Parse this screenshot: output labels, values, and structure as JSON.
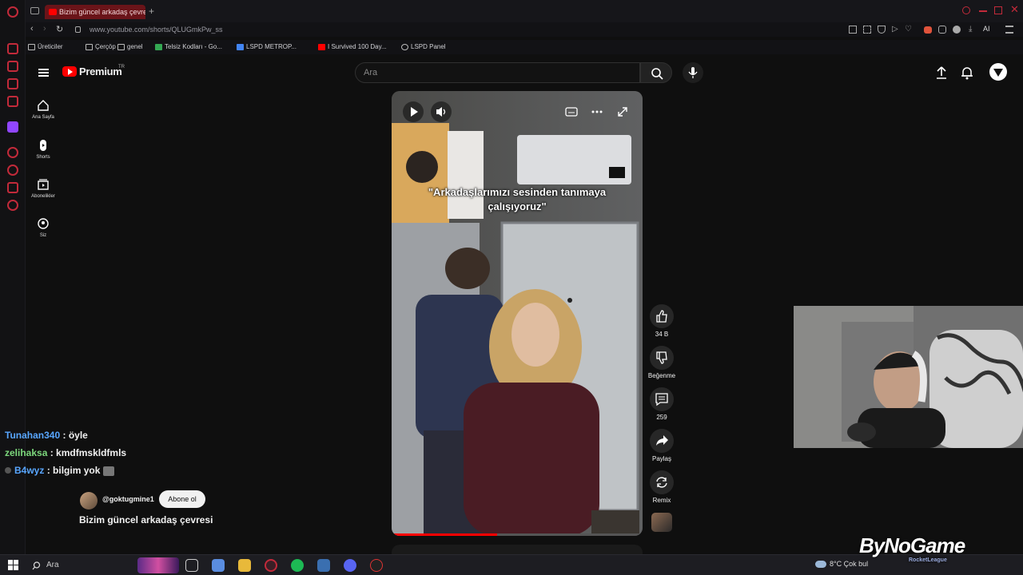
{
  "browser": {
    "tab_title": "Bizim güncel arkadaş çevresi",
    "url": "www.youtube.com/shorts/QLUGmkPw_ss",
    "bookmarks": [
      "Üreticiler",
      "Çerçöp",
      "genel",
      "Telsiz Kodları - Go...",
      "LSPD METROP...",
      "I Survived 100 Day...",
      "LSPD Panel"
    ],
    "toolbar_ai": "AI"
  },
  "youtube": {
    "logo": "Premium",
    "region": "TR",
    "search_placeholder": "Ara",
    "guide": [
      {
        "label": "Ana Sayfa",
        "icon": "home-icon"
      },
      {
        "label": "Shorts",
        "icon": "shorts-icon"
      },
      {
        "label": "Abonelikler",
        "icon": "subscriptions-icon"
      },
      {
        "label": "Siz",
        "icon": "you-icon"
      }
    ],
    "video": {
      "caption": "\"Arkadaşlarımızı sesinden tanımaya çalışıyoruz\"",
      "progress": 0.42,
      "title": "Bizim güncel arkadaş çevresi",
      "channel": "@goktugmine1",
      "subscribe": "Abone ol"
    },
    "actions": {
      "likes": "34 B",
      "dislike": "Beğenme",
      "comments": "259",
      "share": "Paylaş",
      "remix": "Remix"
    }
  },
  "chat": [
    {
      "user": "Tunahan340",
      "message": ": öyle"
    },
    {
      "user": "zelihaksa",
      "message": ": kmdfmskldfmls"
    },
    {
      "user": "B4wyz",
      "message": ": bilgim yok"
    }
  ],
  "taskbar": {
    "search": "Ara",
    "weather": "8°C  Çok bul"
  },
  "watermark": {
    "text": "ByNoGame",
    "sub": "RocketLeague"
  },
  "colors": {
    "accent": "#ff0000",
    "opera": "#c22a3a",
    "background": "#0f0f0f"
  }
}
